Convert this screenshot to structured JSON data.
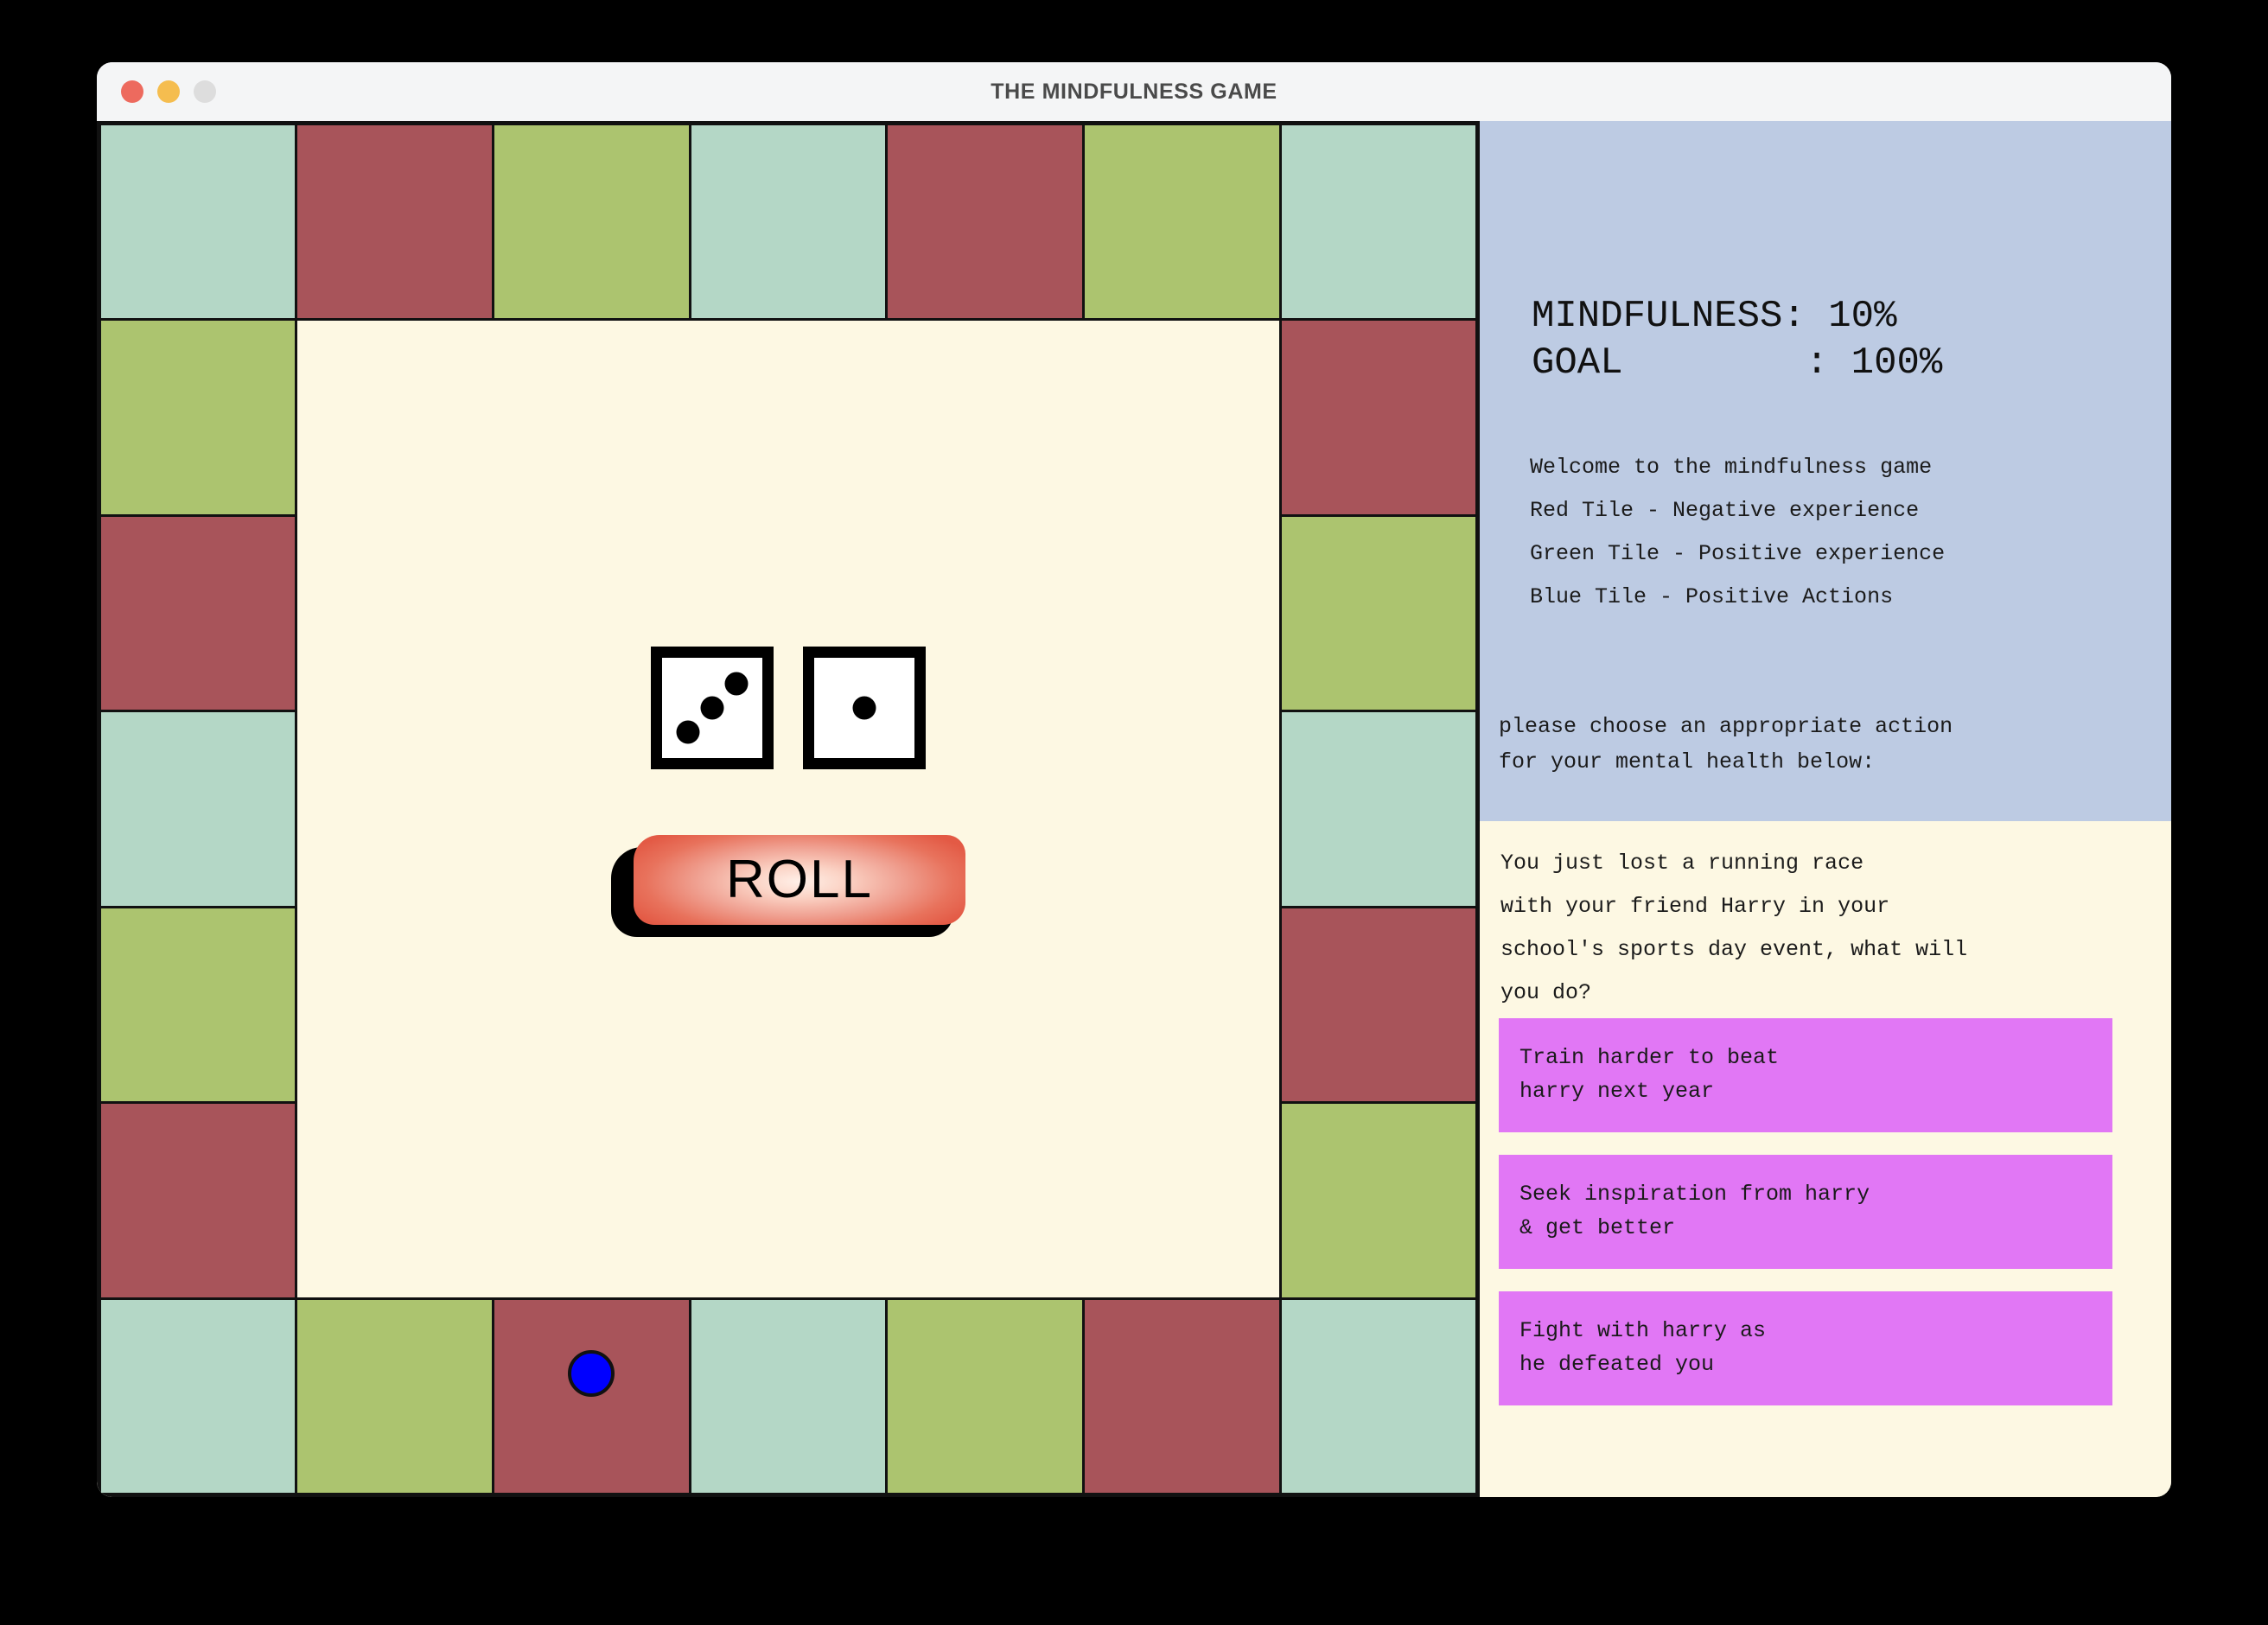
{
  "window": {
    "title": "THE MINDFULNESS GAME",
    "controls": [
      {
        "name": "close",
        "color": "#ed6a5e"
      },
      {
        "name": "minimize",
        "color": "#f5bd4f"
      },
      {
        "name": "maximize",
        "color": "#dddddd"
      }
    ]
  },
  "board": {
    "colors": {
      "red": "#a8545a",
      "green": "#acc46f",
      "teal": "#b4d7c6",
      "center": "#fdf8e3",
      "border": "#111111"
    },
    "top_row": [
      "teal",
      "red",
      "green",
      "teal",
      "red",
      "green",
      "teal"
    ],
    "left_column": [
      "green",
      "red",
      "teal",
      "green",
      "red"
    ],
    "right_column": [
      "red",
      "green",
      "teal",
      "red",
      "green"
    ],
    "bottom_row": [
      "teal",
      "green",
      "red",
      "teal",
      "green",
      "red",
      "teal"
    ],
    "token": {
      "color": "#0000ff",
      "label": "player-token",
      "position_row": "bottom",
      "position_index": 2
    }
  },
  "dice": {
    "die1_value": 3,
    "die2_value": 1,
    "roll_label": "ROLL"
  },
  "status": {
    "lines": "MINDFULNESS: 10%\nGOAL        : 100%",
    "mindfulness_label": "MINDFULNESS",
    "mindfulness_value": "10%",
    "goal_label": "GOAL",
    "goal_value": "100%"
  },
  "legend": {
    "items": [
      "Welcome to the mindfulness game",
      "Red Tile - Negative experience",
      "Green Tile - Positive experience",
      "Blue Tile - Positive Actions"
    ]
  },
  "prompt": {
    "text": "please choose an appropriate action\nfor your mental health below:"
  },
  "scenario": {
    "text": "You just lost a running race\nwith your friend Harry in your\nschool's sports day event, what will\nyou do?"
  },
  "options": [
    {
      "label": "Train harder to beat\nharry next year"
    },
    {
      "label": "Seek inspiration from harry\n& get better"
    },
    {
      "label": "Fight with harry as\nhe defeated you"
    }
  ]
}
